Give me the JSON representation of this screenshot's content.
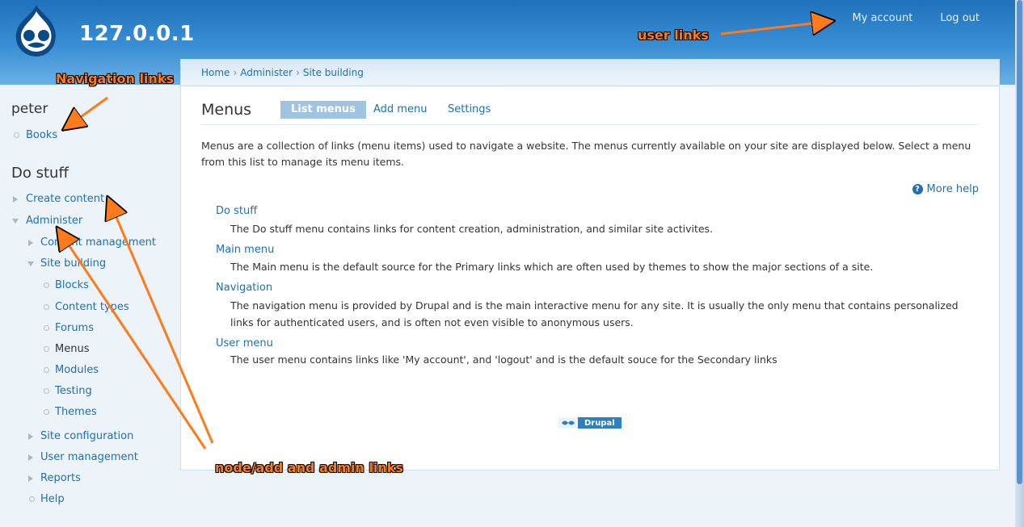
{
  "header": {
    "site_name": "127.0.0.1",
    "user_links": [
      "My account",
      "Log out"
    ]
  },
  "sidebar": {
    "user_block_title": "peter",
    "user_items": [
      {
        "label": "Books"
      }
    ],
    "do_stuff_title": "Do stuff",
    "items": [
      {
        "label": "Create content"
      },
      {
        "label": "Administer"
      },
      {
        "label": "Content management"
      },
      {
        "label": "Site building"
      },
      {
        "label": "Blocks"
      },
      {
        "label": "Content types"
      },
      {
        "label": "Forums"
      },
      {
        "label": "Menus"
      },
      {
        "label": "Modules"
      },
      {
        "label": "Testing"
      },
      {
        "label": "Themes"
      },
      {
        "label": "Site configuration"
      },
      {
        "label": "User management"
      },
      {
        "label": "Reports"
      },
      {
        "label": "Help"
      }
    ]
  },
  "breadcrumb": [
    "Home",
    "Administer",
    "Site building"
  ],
  "breadcrumb_separator": "›",
  "page": {
    "title": "Menus",
    "tabs": [
      {
        "label": "List menus",
        "active": true
      },
      {
        "label": "Add menu",
        "active": false
      },
      {
        "label": "Settings",
        "active": false
      }
    ],
    "intro": "Menus are a collection of links (menu items) used to navigate a website. The menus currently available on your site are displayed below. Select a menu from this list to manage its menu items.",
    "more_help": "More help",
    "help_icon_glyph": "?",
    "menus": [
      {
        "name": "Do stuff",
        "description": "The Do stuff menu contains links for content creation, administration, and similar site activites."
      },
      {
        "name": "Main menu",
        "description": "The Main menu is the default source for the Primary links which are often used by themes to show the major sections of a site."
      },
      {
        "name": "Navigation",
        "description": "The navigation menu is provided by Drupal and is the main interactive menu for any site. It is usually the only menu that contains personalized links for authenticated users, and is often not even visible to anonymous users."
      },
      {
        "name": "User menu",
        "description": "The user menu contains links like 'My account', and 'logout' and is the default souce for the Secondary links"
      }
    ],
    "powered_by": "Drupal"
  },
  "annotations": {
    "user_links": "user links",
    "navigation_links": "Navigation links",
    "admin_links": "node/add and admin links"
  },
  "colors": {
    "link": "#1e6fb5",
    "header_top": "#1f71bb",
    "annotation": "#ff7a1a"
  }
}
